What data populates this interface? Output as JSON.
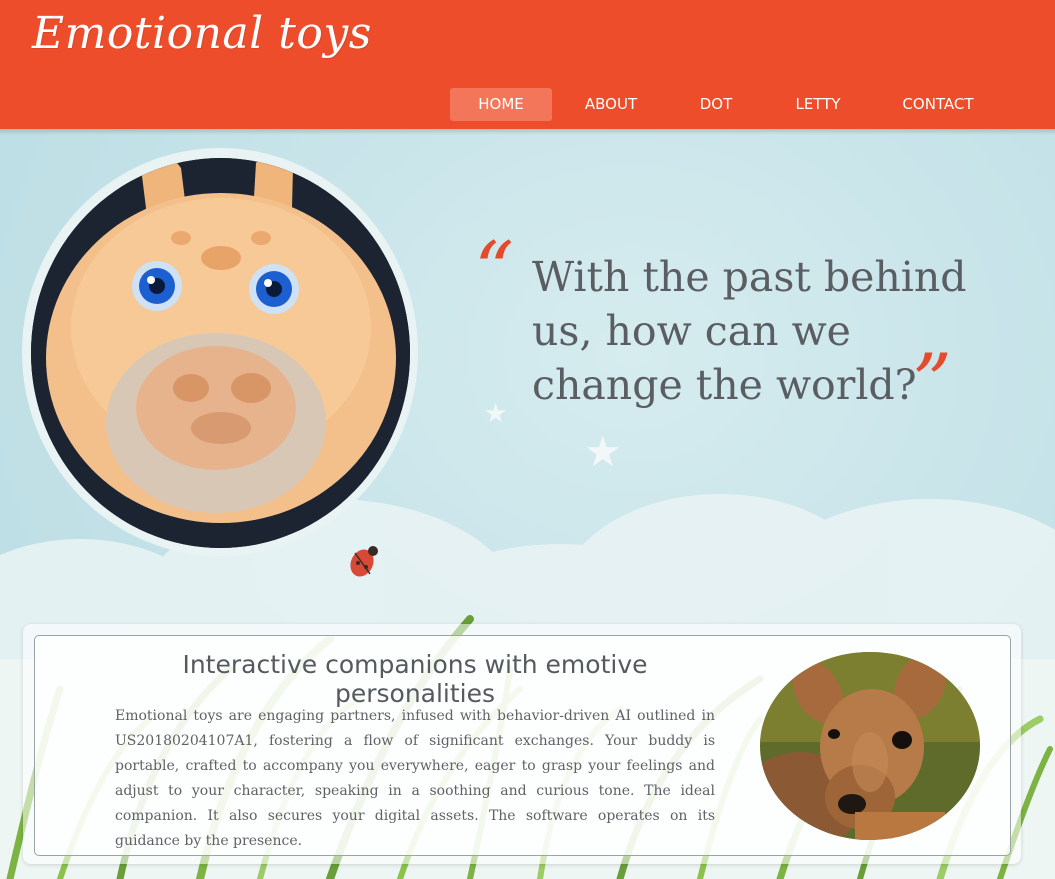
{
  "header": {
    "logo": "Emotional toys",
    "nav": [
      {
        "label": "HOME",
        "active": true
      },
      {
        "label": "ABOUT",
        "active": false
      },
      {
        "label": "DOT",
        "active": false
      },
      {
        "label": "LETTY",
        "active": false
      },
      {
        "label": "CONTACT",
        "active": false
      }
    ]
  },
  "hero": {
    "quote_open": "“",
    "quote_text": "With the past behind us, how can we change the world?",
    "quote_close": "”"
  },
  "panel": {
    "title": "Interactive companions with emotive personalities",
    "body": "Emotional toys are engaging partners, infused with behavior-driven AI outlined in US20180204107A1, fostering a flow of significant exchanges. Your buddy is portable, crafted to accompany you everywhere, eager to grasp your feelings and adjust to your character, speaking in a soothing and curious tone. The ideal companion. It also secures your digital assets. The software operates on its guidance by the presence."
  },
  "colors": {
    "header": "#ee4d2c",
    "nav_active": "#f4765a",
    "quote_mark": "#e54a2c",
    "text": "#5a5e62"
  }
}
